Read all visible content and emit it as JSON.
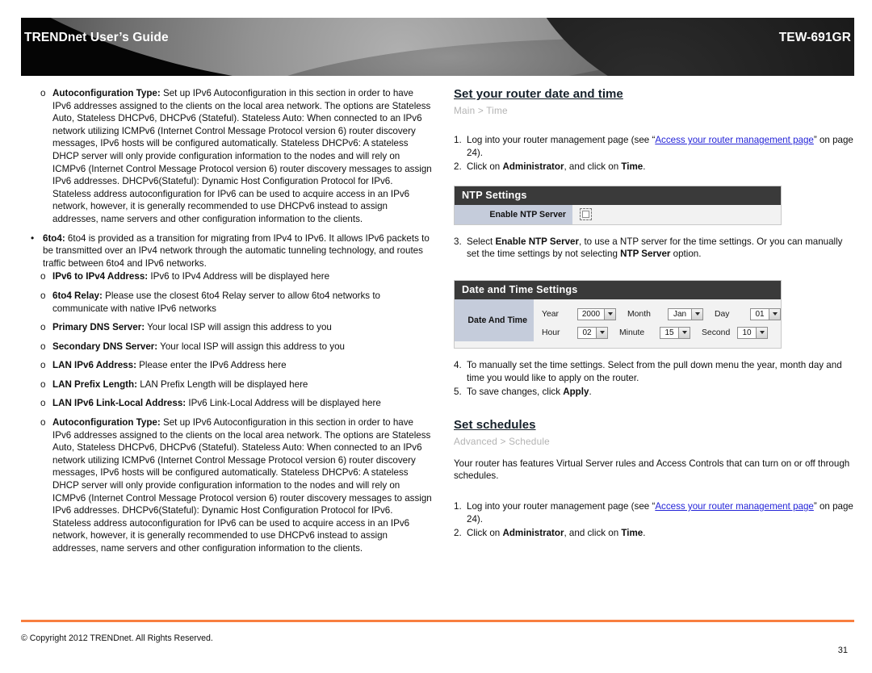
{
  "header": {
    "title": "TRENDnet User’s Guide",
    "model": "TEW-691GR"
  },
  "left_column": {
    "bullets": [
      {
        "marker": "o",
        "level": 2,
        "term": "Autoconfiguration Type:",
        "text": " Set up IPv6 Autoconfiguration in this section in order to have IPv6 addresses assigned to the clients on the local area network.  The options are Stateless Auto, Stateless DHCPv6, DHCPv6 (Stateful).  Stateless Auto: When connected to an IPv6 network utilizing ICMPv6 (Internet Control Message Protocol version 6) router discovery messages, IPv6 hosts will be configured automatically.  Stateless DHCPv6: A stateless DHCP server will only provide configuration information to the nodes and will rely on ICMPv6 (Internet Control Message Protocol version 6) router discovery messages to assign IPv6 addresses. DHCPv6(Stateful): Dynamic Host Configuration Protocol for IPv6. Stateless address autoconfiguration for IPv6 can be used to acquire access in an IPv6 network, however, it is generally recommended to use DHCPv6 instead to assign addresses, name servers and other configuration information to the clients."
      },
      {
        "marker": "•",
        "level": 1,
        "term": "6to4:",
        "text": " 6to4 is provided as a transition for migrating from IPv4 to IPv6. It allows IPv6 packets to be transmitted over an IPv4 network through the automatic tunneling technology, and routes traffic between 6to4 and IPv6 networks."
      },
      {
        "marker": "o",
        "level": 2,
        "term": "IPv6 to IPv4 Address:",
        "text": " IPv6 to IPv4 Address will be displayed here"
      },
      {
        "marker": "o",
        "level": 2,
        "term": "6to4 Relay:",
        "text": " Please use the closest 6to4 Relay server to allow 6to4 networks to communicate with native IPv6 networks"
      },
      {
        "marker": "o",
        "level": 2,
        "term": "Primary DNS Server:",
        "text": " Your local ISP will assign this address to you"
      },
      {
        "marker": "o",
        "level": 2,
        "term": "Secondary DNS Server:",
        "text": " Your local ISP will assign this address to you"
      },
      {
        "marker": "o",
        "level": 2,
        "term": "LAN IPv6 Address:",
        "text": " Please enter the IPv6 Address here"
      },
      {
        "marker": "o",
        "level": 2,
        "term": "LAN Prefix Length:",
        "text": " LAN Prefix Length will be displayed here"
      },
      {
        "marker": "o",
        "level": 2,
        "term": "LAN IPv6 Link-Local Address:",
        "text": " IPv6 Link-Local Address will be displayed here"
      },
      {
        "marker": "o",
        "level": 2,
        "term": "Autoconfiguration Type:",
        "text": " Set up IPv6 Autoconfiguration in this section in order to have IPv6 addresses assigned to the clients on the local area network.  The options are Stateless Auto, Stateless DHCPv6, DHCPv6 (Stateful).  Stateless Auto: When connected to an IPv6 network utilizing ICMPv6 (Internet Control Message Protocol version 6) router discovery messages, IPv6 hosts will be configured automatically.  Stateless DHCPv6: A stateless DHCP server will only provide configuration information to the nodes and will rely on ICMPv6 (Internet Control Message Protocol version 6) router discovery messages to assign IPv6 addresses. DHCPv6(Stateful): Dynamic Host Configuration Protocol for IPv6. Stateless address autoconfiguration for IPv6 can be used to acquire access in an IPv6 network, however, it is generally recommended to use DHCPv6 instead to assign addresses, name servers and other configuration information to the clients."
      }
    ]
  },
  "right_column": {
    "section1": {
      "heading": "Set your router date and time",
      "breadcrumb": "Main > Time",
      "steps": [
        {
          "num": "1.",
          "pre": "Log into your router management page (see “",
          "link": "Access your router management page",
          "post": "” on page 24)."
        },
        {
          "num": "2.",
          "pre": "Click on ",
          "bold1": "Administrator",
          "mid": ", and click on ",
          "bold2": "Time",
          "post": "."
        }
      ],
      "step3": {
        "num": "3.",
        "pre": "Select ",
        "bold1": "Enable NTP Server",
        "mid": ", to use a NTP server for the time settings. Or you can manually set the time settings by not selecting ",
        "bold2": "NTP Server",
        "post": " option."
      },
      "step4": {
        "num": "4.",
        "text": "To manually set the time settings. Select from the pull down menu the year, month day and time you would like to apply on the router."
      },
      "step5": {
        "num": "5.",
        "pre": "To save changes, click ",
        "bold1": "Apply",
        "post": "."
      }
    },
    "ntp_panel": {
      "title": "NTP Settings",
      "label": "Enable NTP Server",
      "checkbox_checked": false
    },
    "datetime_panel": {
      "title": "Date and Time Settings",
      "label": "Date And Time",
      "fields": [
        {
          "label": "Year",
          "value": "2000"
        },
        {
          "label": "Month",
          "value": "Jan"
        },
        {
          "label": "Day",
          "value": "01"
        },
        {
          "label": "Hour",
          "value": "02"
        },
        {
          "label": "Minute",
          "value": "15"
        },
        {
          "label": "Second",
          "value": "10"
        }
      ]
    },
    "section2": {
      "heading": "Set schedules",
      "breadcrumb": "Advanced > Schedule",
      "intro": "Your router has features Virtual Server rules and Access Controls that can turn on or off through schedules.",
      "steps": [
        {
          "num": "1.",
          "pre": "Log into your router management page (see “",
          "link": "Access your router management page",
          "post": "” on page 24)."
        },
        {
          "num": "2.",
          "pre": "Click on ",
          "bold1": "Administrator",
          "mid": ", and click on ",
          "bold2": "Time",
          "post": "."
        }
      ]
    }
  },
  "footer": {
    "copyright": "© Copyright 2012 TRENDnet. All Rights Reserved.",
    "page_number": "31",
    "rule_color": "#F87F3F"
  }
}
